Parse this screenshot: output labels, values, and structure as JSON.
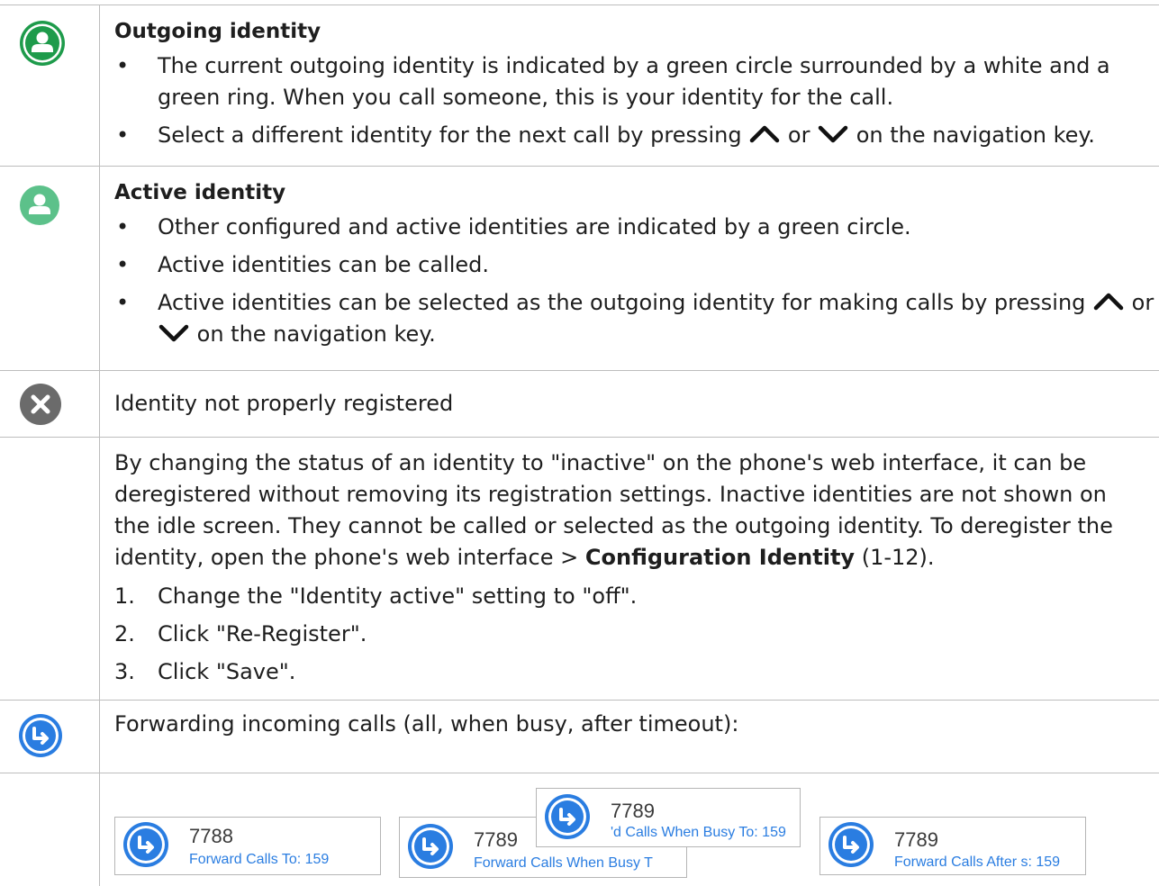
{
  "rows": {
    "outgoing": {
      "icon": "outgoing-identity-icon",
      "title": "Outgoing identity",
      "bullet1": "The current outgoing identity is indicated by a green circle surrounded by a white and a green ring. When you call someone, this is your identity for the call.",
      "bullet2_pre": "Select a different identity for the next call by pressing",
      "or": "or",
      "bullet2_post": "on the navigation key."
    },
    "active": {
      "icon": "active-identity-icon",
      "title": "Active identity",
      "bullet1": "Other configured and active identities are indicated by a green circle.",
      "bullet2": "Active identities can be called.",
      "bullet3_pre": "Active identities can be selected as the outgoing identity for making calls by pressing",
      "or": "or",
      "bullet3_post": "on the navigation key."
    },
    "not_registered": {
      "icon": "not-registered-icon",
      "text": "Identity not properly registered"
    },
    "inactive": {
      "para_pre": "By changing the status of an identity to \"inactive\" on the phone's web interface, it can be deregistered without removing its registration settings.  Inactive identities are not shown on the idle screen.  They cannot be called or selected as the outgoing identity.  To deregister the identity, open the phone's web interface  >  ",
      "para_bold": "Configuration Identity",
      "para_post": " (1-12).",
      "steps": [
        {
          "n": "1.",
          "text": "Change the \"Identity active\" setting to \"off\"."
        },
        {
          "n": "2.",
          "text": "Click \"Re-Register\"."
        },
        {
          "n": "3.",
          "text": "Click \"Save\"."
        }
      ]
    },
    "forwarding": {
      "icon": "forward-icon",
      "text": "Forwarding incoming calls (all, when busy, after timeout):"
    },
    "cards": [
      {
        "number": "7788",
        "label": "Forward Calls To: 159"
      },
      {
        "number": "7789",
        "label": "Forward Calls When Busy T"
      },
      {
        "number": "7789",
        "label": "'d Calls When Busy To: 159"
      },
      {
        "number": "7789",
        "label": "Forward Calls After s: 159"
      }
    ]
  },
  "colors": {
    "green_dark": "#1e9b4b",
    "green_light": "#5cc18a",
    "grey": "#6b6b6b",
    "blue": "#2a7de1"
  }
}
